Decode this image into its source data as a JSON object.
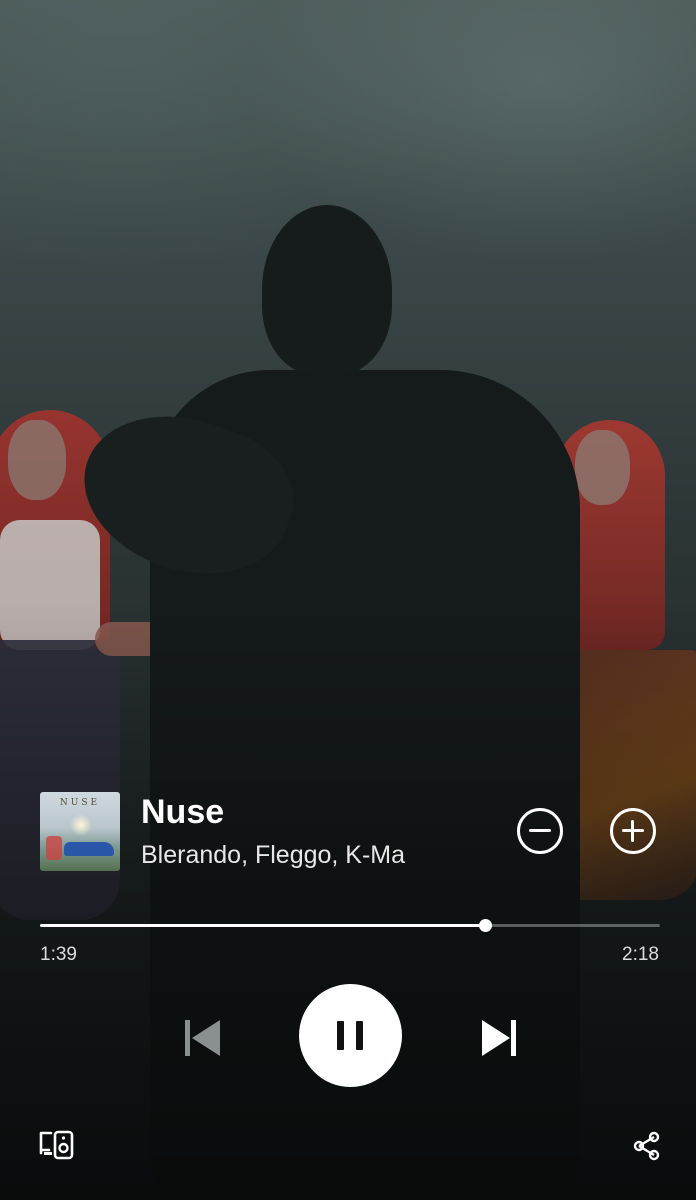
{
  "track": {
    "title": "Nuse",
    "artists": "Blerando, Fleggo, K-Ma",
    "cover_text": "NUSE"
  },
  "playback": {
    "elapsed": "1:39",
    "duration": "2:18",
    "progress_fraction": 0.717,
    "state": "playing"
  },
  "icons": {
    "remove": "minus-circle-icon",
    "add": "plus-circle-icon",
    "previous": "skip-previous-icon",
    "pause": "pause-icon",
    "next": "skip-next-icon",
    "devices": "connect-device-icon",
    "share": "share-icon"
  },
  "colors": {
    "accent": "#ffffff",
    "progress_rail": "#ffffff52",
    "background": "#1c2224"
  }
}
